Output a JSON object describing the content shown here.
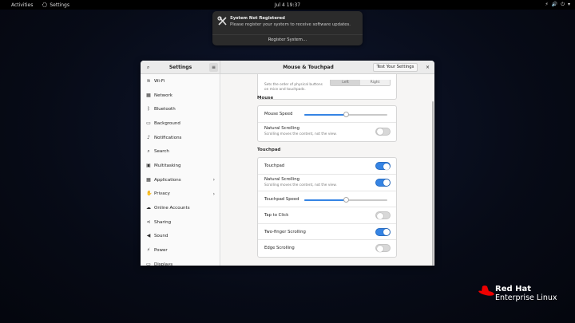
{
  "topbar": {
    "activities": "Activities",
    "app_name": "Settings",
    "clock": "Jul 4  19:37",
    "tray": [
      "⚡",
      "🔊",
      "⏻",
      "▾"
    ]
  },
  "notification": {
    "icon": "tools-icon",
    "title": "System Not Registered",
    "body": "Please register your system to receive software updates.",
    "action": "Register System…"
  },
  "window": {
    "sidebar_title": "Settings",
    "main_title": "Mouse & Touchpad",
    "test_button": "Test Your Settings",
    "close": "×"
  },
  "sidebar": {
    "items": [
      {
        "label": "Wi-Fi",
        "icon": "wifi-icon",
        "glyph": "≋",
        "chevron": false
      },
      {
        "label": "Network",
        "icon": "network-icon",
        "glyph": "▦",
        "chevron": false
      },
      {
        "label": "Bluetooth",
        "icon": "bluetooth-icon",
        "glyph": "ᛒ",
        "chevron": false
      },
      {
        "label": "Background",
        "icon": "background-icon",
        "glyph": "▭",
        "chevron": false
      },
      {
        "label": "Notifications",
        "icon": "bell-icon",
        "glyph": "♪",
        "chevron": false
      },
      {
        "label": "Search",
        "icon": "search-icon",
        "glyph": "⌕",
        "chevron": false
      },
      {
        "label": "Multitasking",
        "icon": "multitasking-icon",
        "glyph": "▣",
        "chevron": false
      },
      {
        "label": "Applications",
        "icon": "applications-icon",
        "glyph": "▦",
        "chevron": true
      },
      {
        "label": "Privacy",
        "icon": "hand-icon",
        "glyph": "✋",
        "chevron": true
      },
      {
        "label": "Online Accounts",
        "icon": "cloud-icon",
        "glyph": "☁",
        "chevron": false
      },
      {
        "label": "Sharing",
        "icon": "share-icon",
        "glyph": "⋖",
        "chevron": false
      },
      {
        "label": "Sound",
        "icon": "sound-icon",
        "glyph": "◀",
        "chevron": false
      },
      {
        "label": "Power",
        "icon": "power-icon",
        "glyph": "⚡",
        "chevron": false
      },
      {
        "label": "Displays",
        "icon": "display-icon",
        "glyph": "▭",
        "chevron": false
      }
    ]
  },
  "content": {
    "general": {
      "partial_line1": "Sets the order of physical buttons",
      "partial_line2": "on mice and touchpads.",
      "seg_left": "Left",
      "seg_right": "Right"
    },
    "mouse_header": "Mouse",
    "mouse_speed": {
      "label": "Mouse Speed",
      "value": 0.5
    },
    "mouse_natural": {
      "label": "Natural Scrolling",
      "sub": "Scrolling moves the content, not the view.",
      "on": false
    },
    "touchpad_header": "Touchpad",
    "touchpad_toggle": {
      "label": "Touchpad",
      "on": true
    },
    "touchpad_natural": {
      "label": "Natural Scrolling",
      "sub": "Scrolling moves the content, not the view.",
      "on": true
    },
    "touchpad_speed": {
      "label": "Touchpad Speed",
      "value": 0.5
    },
    "tap_to_click": {
      "label": "Tap to Click",
      "on": false
    },
    "two_finger": {
      "label": "Two-finger Scrolling",
      "on": true
    },
    "edge_scrolling": {
      "label": "Edge Scrolling",
      "on": false
    }
  },
  "logo": {
    "line1": "Red Hat",
    "line2": "Enterprise Linux",
    "color": "#ee0000"
  }
}
